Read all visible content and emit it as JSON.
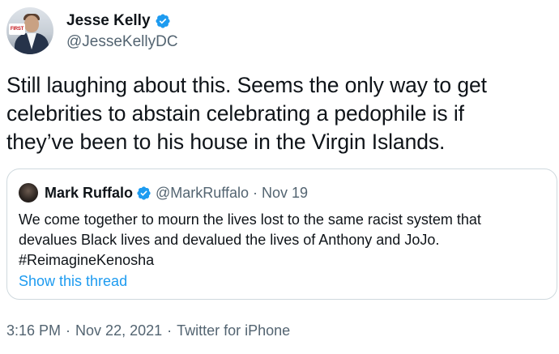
{
  "author": {
    "display_name": "Jesse Kelly",
    "handle": "@JesseKellyDC",
    "avatar_badge": "FIRST",
    "verified": true
  },
  "tweet": {
    "lines": [
      "Still laughing about this. Seems the only way to get",
      "celebrities to abstain celebrating a pedophile is if",
      "they’ve been to his house in the Virgin Islands."
    ]
  },
  "quote": {
    "display_name": "Mark Ruffalo",
    "handle": "@MarkRuffalo",
    "separator": "·",
    "date": "Nov 19",
    "verified": true,
    "lines": [
      "We come together to mourn the lives lost to the same racist system that",
      "devalues Black lives and devalued the lives of Anthony and JoJo.",
      "#ReimagineKenosha"
    ],
    "show_thread_label": "Show this thread"
  },
  "meta": {
    "time": "3:16 PM",
    "separator": "·",
    "date": "Nov 22, 2021",
    "source": "Twitter for iPhone"
  },
  "colors": {
    "text": "#0f1419",
    "secondary": "#536471",
    "link": "#1d9bf0",
    "verified": "#1d9bf0",
    "border": "#cfd9de"
  },
  "icons": {
    "verified": "verified-badge-icon"
  }
}
